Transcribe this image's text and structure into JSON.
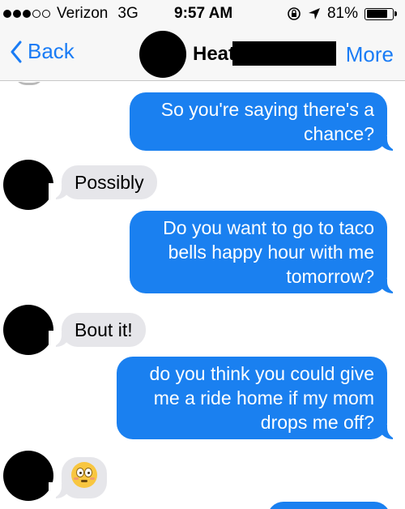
{
  "status_bar": {
    "carrier": "Verizon",
    "network": "3G",
    "time": "9:57 AM",
    "battery": "81%",
    "battery_level": 0.81,
    "icons": [
      "signal-dots-icon",
      "rotation-lock-icon",
      "location-arrow-icon",
      "battery-icon"
    ]
  },
  "nav_bar": {
    "back_label": "Back",
    "contact_name": "Heat",
    "more_label": "More"
  },
  "messages": [
    {
      "direction": "outgoing",
      "text": "So you're saying there's a chance?"
    },
    {
      "direction": "incoming",
      "text": "Possibly"
    },
    {
      "direction": "outgoing",
      "text": "Do you want to go to taco bells happy hour with me tomorrow?"
    },
    {
      "direction": "incoming",
      "text": "Bout it!"
    },
    {
      "direction": "outgoing",
      "text": "do you think you could give me a ride home if my mom drops me off?"
    },
    {
      "direction": "incoming",
      "emoji": "flushed-face-icon"
    }
  ],
  "colors": {
    "accent": "#1a7cf5",
    "outgoing_bubble": "#1a80f0",
    "incoming_bubble": "#e6e6ea"
  }
}
